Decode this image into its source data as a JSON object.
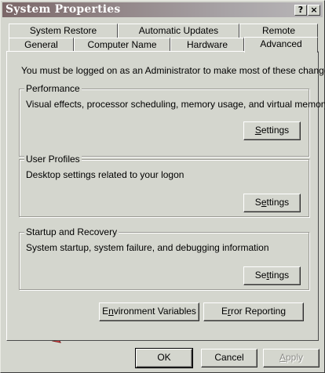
{
  "window": {
    "title": "System Properties"
  },
  "title_buttons": {
    "help": "?",
    "close": "×"
  },
  "tabs_back": [
    "System Restore",
    "Automatic Updates",
    "Remote"
  ],
  "tabs_front": [
    "General",
    "Computer Name",
    "Hardware",
    "Advanced"
  ],
  "active_tab": "Advanced",
  "panel": {
    "intro": "You must be logged on as an Administrator to make most of these changes."
  },
  "groups": [
    {
      "label": "Performance",
      "description": "Visual effects, processor scheduling, memory usage, and virtual memory",
      "button": "Settings"
    },
    {
      "label": "User Profiles",
      "description": "Desktop settings related to your logon",
      "button": "Settings"
    },
    {
      "label": "Startup and Recovery",
      "description": "System startup, system failure, and debugging information",
      "button": "Settings"
    }
  ],
  "buttons": {
    "environment_variables": "Environment Variables",
    "error_reporting": "Error Reporting"
  },
  "dialog_buttons": {
    "ok": "OK",
    "cancel": "Cancel",
    "apply": "Apply"
  },
  "icons": {
    "annotation_arrow": "red-arrow-icon"
  },
  "colors": {
    "arrow": "#d8262a",
    "title_gradient_start": "#7b6768"
  }
}
